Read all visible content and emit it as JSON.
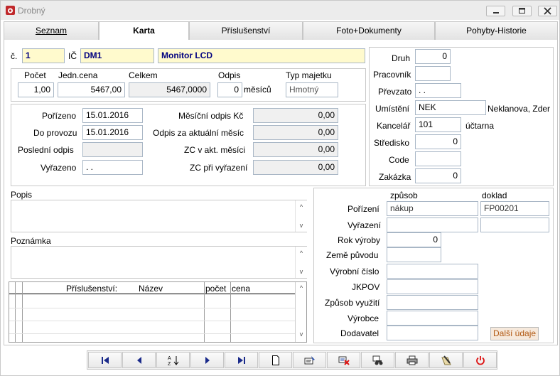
{
  "window": {
    "title": "Drobný"
  },
  "tabs": [
    {
      "label": "Seznam"
    },
    {
      "label": "Karta"
    },
    {
      "label": "Příslušenství"
    },
    {
      "label": "Foto+Dokumenty"
    },
    {
      "label": "Pohyby-Historie"
    }
  ],
  "header": {
    "cislo_label": "č.",
    "cislo": "1",
    "ic_label": "IČ",
    "ic": "DM1",
    "name": "Monitor LCD"
  },
  "price": {
    "pocet_label": "Počet",
    "pocet": "1,00",
    "jedn_label": "Jedn.cena",
    "jedn": "5467,00",
    "celkem_label": "Celkem",
    "celkem": "5467,0000",
    "odpis_label": "Odpis",
    "odpis": "0",
    "mesicu": "měsíců",
    "typ_label": "Typ majetku",
    "typ": "Hmotný"
  },
  "dates": {
    "porizeno_label": "Pořízeno",
    "porizeno": "15.01.2016",
    "do_provozu_label": "Do provozu",
    "do_provozu": "15.01.2016",
    "posledni_label": "Poslední odpis",
    "posledni": "",
    "vyrazeno_label": "Vyřazeno",
    "vyrazeno": ". ."
  },
  "odpisy": {
    "mesicni_label": "Měsíční odpis Kč",
    "mesicni": "0,00",
    "aktualni_label": "Odpis za aktuální měsíc",
    "aktualni": "0,00",
    "zc_akt_label": "ZC v akt. měsíci",
    "zc_akt": "0,00",
    "zc_vyr_label": "ZC při vyřazení",
    "zc_vyr": "0,00"
  },
  "right": {
    "druh_label": "Druh",
    "druh": "0",
    "pracovnik_label": "Pracovník",
    "pracovnik": "",
    "prevzato_label": "Převzato",
    "prevzato": ". .",
    "umisteni_label": "Umístění",
    "umisteni": "NEK",
    "umisteni_text": "Neklanova, Zder",
    "kancelar_label": "Kancelář",
    "kancelar": "101",
    "kancelar_text": "účtarna",
    "stredisko_label": "Středisko",
    "stredisko": "0",
    "code_label": "Code",
    "code": "",
    "zakazka_label": "Zakázka",
    "zakazka": "0"
  },
  "notes": {
    "popis_label": "Popis",
    "poznamka_label": "Poznámka"
  },
  "accessories": {
    "columns": [
      "Příslušenství:",
      "Název",
      "počet",
      "cena"
    ]
  },
  "acquisition": {
    "zpusob_header": "způsob",
    "doklad_header": "doklad",
    "porizeni_label": "Pořízení",
    "porizeni_zpusob": "nákup",
    "porizeni_doklad": "FP00201",
    "vyrazeni_label": "Vyřazení",
    "rok_label": "Rok výroby",
    "rok": "0",
    "zeme_label": "Země původu",
    "vyrobni_label": "Výrobní číslo",
    "jkpov_label": "JKPOV",
    "vyuziti_label": "Způsob využití",
    "vyrobce_label": "Výrobce",
    "dodavatel_label": "Dodavatel",
    "dalsi_button": "Další údaje"
  }
}
